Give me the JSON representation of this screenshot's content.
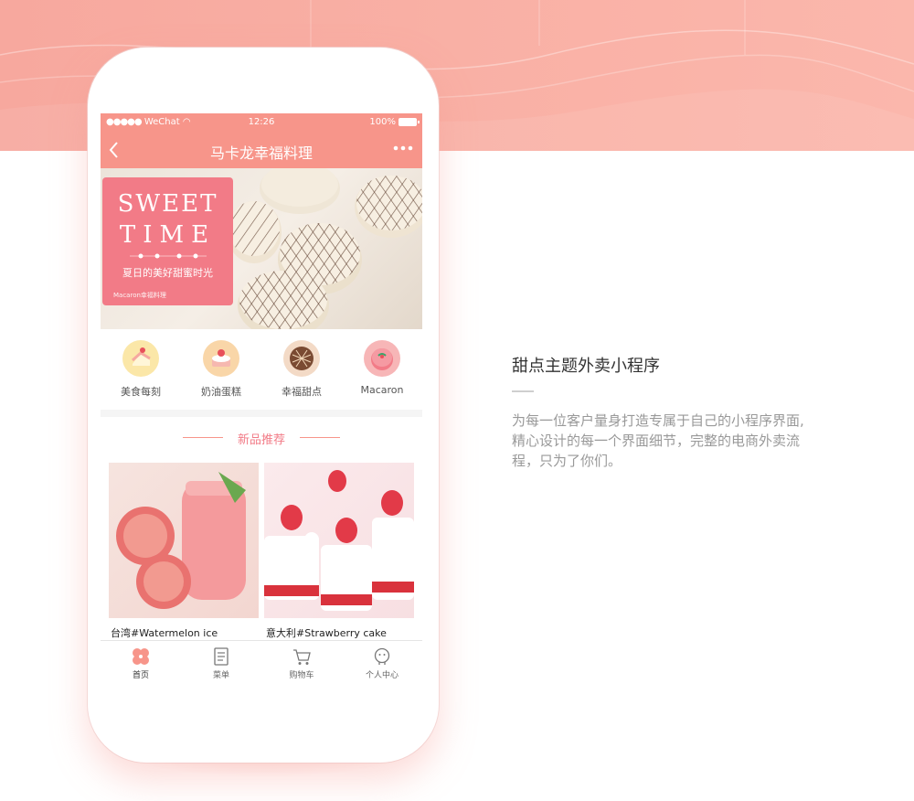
{
  "app": {
    "status_bar": {
      "carrier": "WeChat",
      "time": "12:26",
      "battery": "100%"
    },
    "nav": {
      "title": "马卡龙幸福料理",
      "back_icon": "chevron-left-icon",
      "more_icon": "more-dots-icon"
    },
    "banner": {
      "line1": "SWEET",
      "line2": "TIME",
      "subtitle": "夏日的美好甜蜜时光",
      "brand": "Macaron幸福料理"
    },
    "categories": [
      {
        "label": "美食每刻",
        "icon": "cake-slice-icon"
      },
      {
        "label": "奶油蛋糕",
        "icon": "cream-cake-icon"
      },
      {
        "label": "幸福甜点",
        "icon": "chocolate-cake-icon"
      },
      {
        "label": "Macaron",
        "icon": "macaron-icon"
      }
    ],
    "section_title": "新品推荐",
    "products": [
      {
        "name": "台湾#Watermelon ice"
      },
      {
        "name": "意大利#Strawberry cake"
      }
    ],
    "tabs": [
      {
        "label": "首页",
        "icon": "home-clover-icon",
        "active": true
      },
      {
        "label": "菜单",
        "icon": "menu-list-icon",
        "active": false
      },
      {
        "label": "购物车",
        "icon": "cart-icon",
        "active": false
      },
      {
        "label": "个人中心",
        "icon": "profile-icon",
        "active": false
      }
    ]
  },
  "side": {
    "title": "甜点主题外卖小程序",
    "description": "为每一位客户量身打造专属于自己的小程序界面,精心设计的每一个界面细节，完整的电商外卖流程，只为了你们。"
  },
  "colors": {
    "accent": "#f7958a",
    "accent_dark": "#f27b87",
    "band": "#f9b0a5"
  }
}
